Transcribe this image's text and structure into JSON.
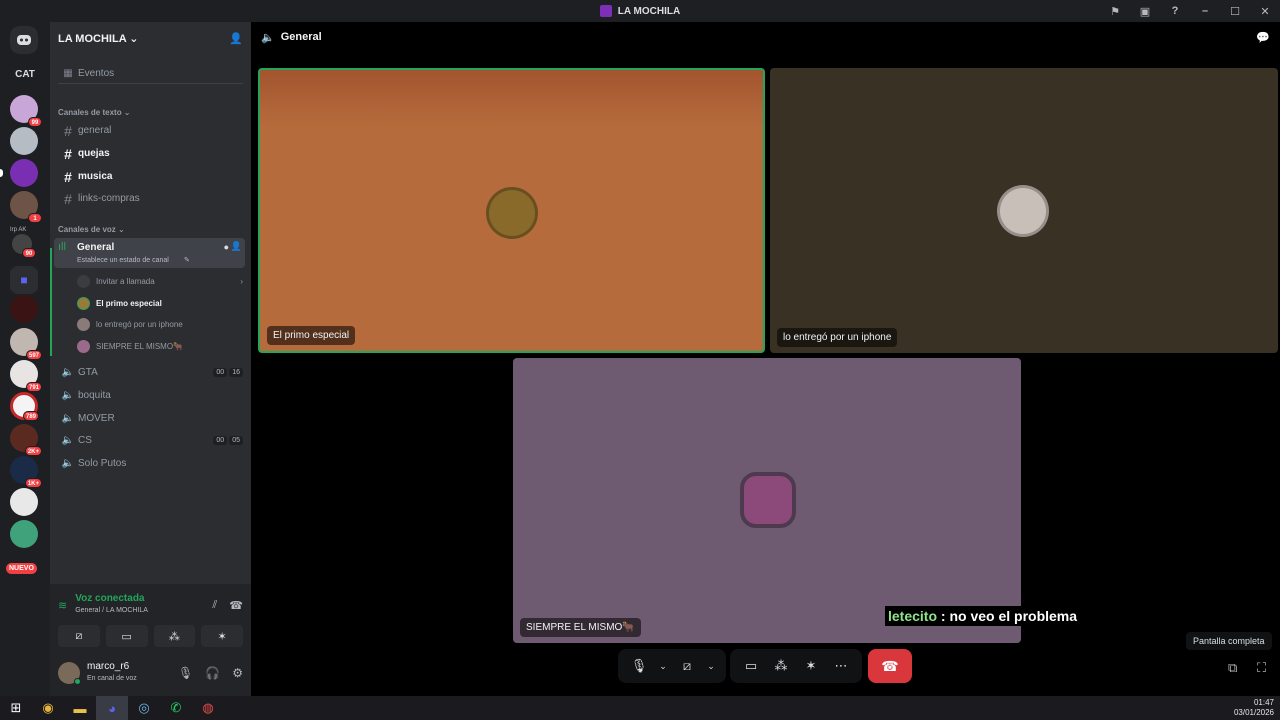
{
  "window": {
    "title": "LA MOCHILA"
  },
  "server": {
    "name": "LA MOCHILA",
    "events_label": "Eventos",
    "text_category": "Canales de texto",
    "text_channels": [
      "general",
      "quejas",
      "musica",
      "links-compras"
    ],
    "voice_category": "Canales de voz",
    "active_voice": {
      "name": "General",
      "status": "Establece un estado de canal",
      "invite_label": "Invitar a llamada",
      "members": [
        "El primo especial",
        "lo entregó por un iphone",
        "SIEMPRE EL MISMO🐂"
      ]
    },
    "other_voice": [
      {
        "name": "GTA",
        "pills": [
          "00",
          "16"
        ]
      },
      {
        "name": "boquita",
        "pills": []
      },
      {
        "name": "MOVER",
        "pills": []
      },
      {
        "name": "CS",
        "pills": [
          "00",
          "05"
        ]
      },
      {
        "name": "Solo Putos",
        "pills": []
      }
    ]
  },
  "guilds": {
    "cat_label": "CAT",
    "irp_label": "Irp AK",
    "new_label": "NUEVO",
    "badges": [
      "99",
      "1",
      "90",
      "597",
      "791",
      "789",
      "2K+",
      "1K+"
    ]
  },
  "voice_panel": {
    "connected_label": "Voz conectada",
    "location": "General / LA MOCHILA"
  },
  "user": {
    "name": "marco_r6",
    "status": "En canal de voz"
  },
  "call": {
    "channel_title": "General",
    "tiles": [
      {
        "name": "El primo especial",
        "bg": "#b66b3c"
      },
      {
        "name": "lo entregó por un iphone",
        "bg": "#3a3125"
      },
      {
        "name": "SIEMPRE EL MISMO🐂",
        "bg": "#6f5b71"
      }
    ],
    "caption": {
      "speaker": "letecito",
      "text": " : no veo el problema"
    },
    "tooltip": "Pantalla completa"
  },
  "clock": {
    "time": "01:47",
    "date": "03/01/2026"
  },
  "colors": {
    "accent": "#23a55a",
    "danger": "#da373c",
    "blurple": "#5865f2"
  }
}
